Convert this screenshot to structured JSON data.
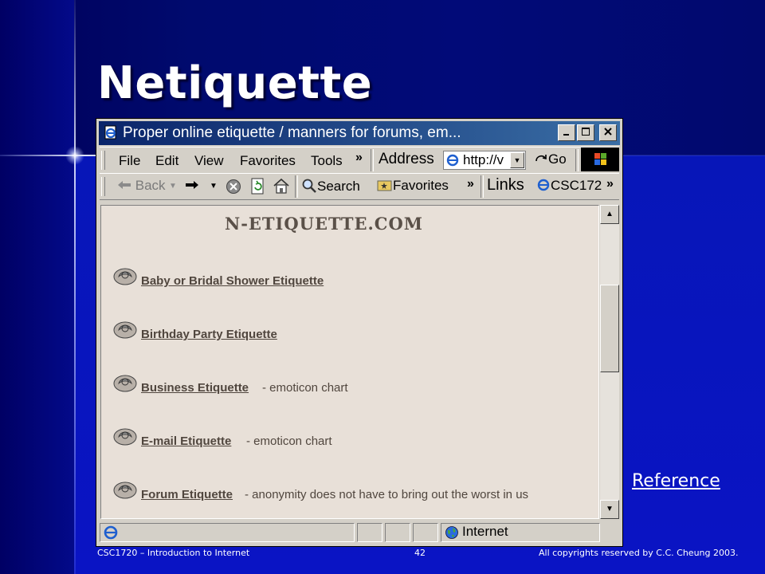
{
  "slide": {
    "title": "Netiquette",
    "reference_link": "Reference",
    "footer": {
      "course": "CSC1720 – Introduction to Internet",
      "page": "42",
      "copyright": "All copyrights reserved by C.C. Cheung 2003."
    }
  },
  "browser": {
    "window_title": "Proper online etiquette / manners for forums, em...",
    "menu": [
      "File",
      "Edit",
      "View",
      "Favorites",
      "Tools"
    ],
    "menu_chevron": "»",
    "address_label": "Address",
    "address_value": "http://v",
    "go_label": "Go",
    "toolbar": {
      "back_label": "Back",
      "search_label": "Search",
      "favorites_label": "Favorites",
      "links_label": "Links",
      "link_item": "CSC172"
    },
    "status_zone": "Internet",
    "page": {
      "site_title": "N-ETIQUETTE.COM",
      "links": [
        {
          "text": "Baby  or Bridal Shower  Etiquette",
          "note": ""
        },
        {
          "text": "Birthday Party Etiquette",
          "note": ""
        },
        {
          "text": "Business Etiquette",
          "note": " - emoticon chart"
        },
        {
          "text": "E-mail Etiquette",
          "note": " -  emoticon chart"
        },
        {
          "text": "Forum Etiquette",
          "note": "  - anonymity does not have to bring out the worst in us"
        }
      ]
    }
  },
  "colors": {
    "slide_background": "#0a14c4",
    "page_background": "#e8e0d8",
    "titlebar_start": "#0a246a",
    "titlebar_end": "#3a6ea5"
  }
}
